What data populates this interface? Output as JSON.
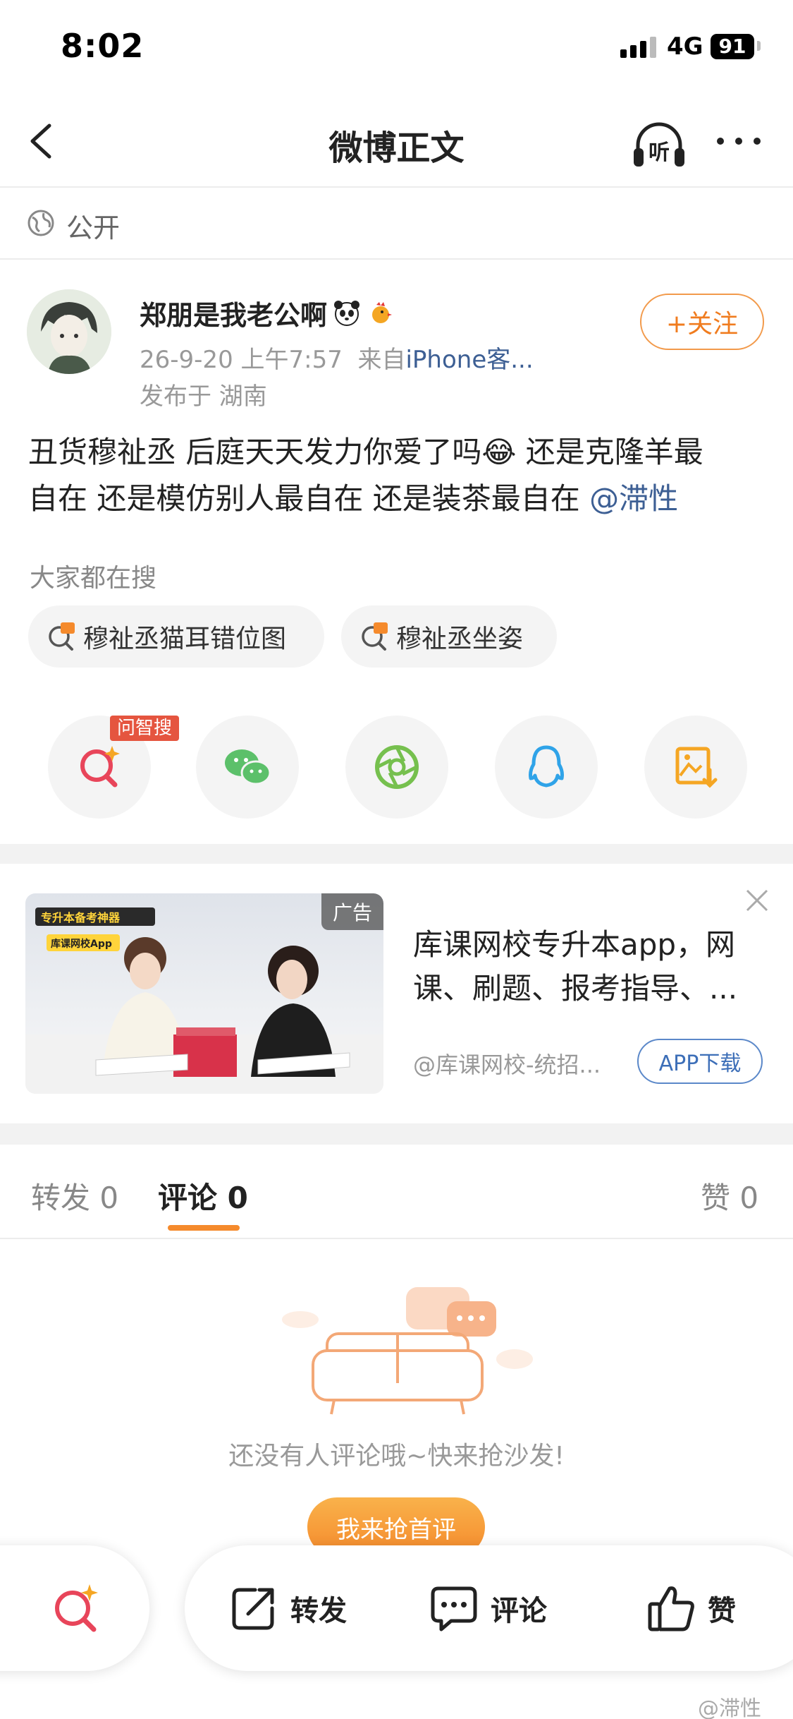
{
  "status_bar": {
    "time": "8:02",
    "network": "4G",
    "battery": "91"
  },
  "nav": {
    "title": "微博正文",
    "listen_label": "听"
  },
  "visibility": "公开",
  "post": {
    "username": "郑朋是我老公啊",
    "time": "26-9-20 上午7:57",
    "from_prefix": "来自",
    "source": "iPhone客...",
    "location": "发布于 湖南",
    "follow_label": "+关注",
    "text_line1": "丑货穆祉丞 后庭天天发力你爱了吗😂 还是克隆羊最",
    "text_line2_plain": "自在 还是模仿别人最自在 还是装茶最自在 ",
    "mention": "@滞性"
  },
  "search": {
    "title": "大家都在搜",
    "chips": [
      "穆祉丞猫耳错位图",
      "穆祉丞坐姿"
    ]
  },
  "share": {
    "ask_badge": "问智搜"
  },
  "ad": {
    "tag": "广告",
    "img_text_1": "专升本备考神器",
    "img_text_2": "库课网校App",
    "title_line1": "库课网校专升本app，网",
    "title_line2": "课、刷题、报考指导、...",
    "source": "@库课网校-统招...",
    "button": "APP下载"
  },
  "tabs": {
    "repost": "转发 0",
    "comment": "评论 0",
    "like": "赞 0"
  },
  "empty": {
    "text": "还没有人评论哦~快来抢沙发!",
    "button": "我来抢首评"
  },
  "bottom": {
    "repost": "转发",
    "comment": "评论",
    "like": "赞"
  },
  "watermark": "@滞性",
  "colors": {
    "accent": "#f58a2c",
    "link": "#3d5f94",
    "badge": "#e5553f"
  }
}
